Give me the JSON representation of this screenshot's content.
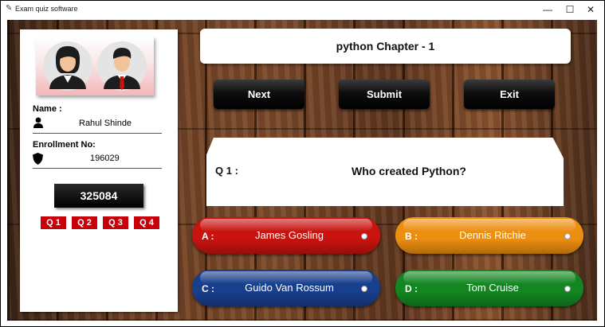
{
  "window": {
    "title": "Exam quiz software",
    "minimize_glyph": "—",
    "maximize_glyph": "☐",
    "close_glyph": "✕"
  },
  "profile": {
    "name_label": "Name :",
    "name_value": "Rahul Shinde",
    "enrollment_label": "Enrollment No:",
    "enrollment_value": "196029",
    "code": "325084",
    "question_tabs": [
      "Q 1",
      "Q 2",
      "Q 3",
      "Q 4"
    ]
  },
  "header": {
    "title": "python Chapter - 1"
  },
  "nav": {
    "next": "Next",
    "submit": "Submit",
    "exit": "Exit"
  },
  "question": {
    "number": "Q 1 :",
    "text": "Who created Python?"
  },
  "options": [
    {
      "letter": "A :",
      "text": "James Gosling",
      "color": "#c8130f"
    },
    {
      "letter": "B :",
      "text": "Dennis Ritchie",
      "color": "#ec8e10"
    },
    {
      "letter": "C :",
      "text": "Guido Van Rossum",
      "color": "#183f8c"
    },
    {
      "letter": "D :",
      "text": "Tom Cruise",
      "color": "#138622"
    }
  ],
  "icons": {
    "app": "feather-icon",
    "user": "person-icon",
    "enrollment": "shield-icon"
  }
}
